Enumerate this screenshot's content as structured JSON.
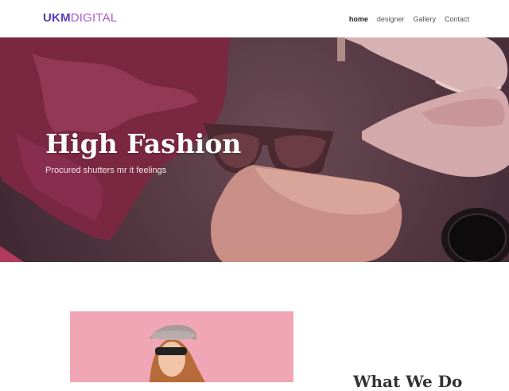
{
  "header": {
    "logo_bold": "UKM",
    "logo_light": "DIGITAL",
    "nav": [
      {
        "label": "home",
        "active": true
      },
      {
        "label": "designer",
        "active": false
      },
      {
        "label": "Gallery",
        "active": false
      },
      {
        "label": "Contact",
        "active": false
      }
    ]
  },
  "hero": {
    "title": "High Fashion",
    "subtitle": "Procured shutters mr it feelings"
  },
  "section": {
    "title": "What We Do"
  },
  "colors": {
    "brand_primary": "#5b3bc4",
    "brand_secondary": "#b05ad6",
    "hero_background": "#523640",
    "card_background": "#f0a6b4"
  }
}
